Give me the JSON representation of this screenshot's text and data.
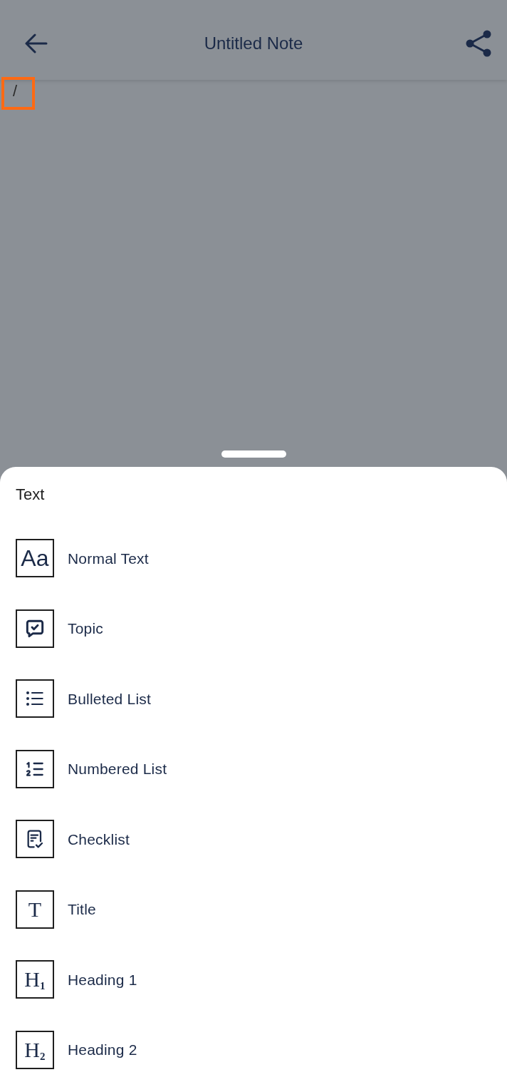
{
  "header": {
    "title": "Untitled Note"
  },
  "note": {
    "text": "/",
    "highlighted": true
  },
  "sheet": {
    "section_label": "Text",
    "items": [
      {
        "kind": "sans-glyph",
        "glyph": "Aa",
        "label": "Normal Text"
      },
      {
        "kind": "topic",
        "label": "Topic"
      },
      {
        "kind": "bulleted",
        "label": "Bulleted List"
      },
      {
        "kind": "numbered",
        "label": "Numbered List"
      },
      {
        "kind": "checklist",
        "label": "Checklist"
      },
      {
        "kind": "serif-glyph",
        "glyph": "T",
        "label": "Title"
      },
      {
        "kind": "serif-glyph",
        "glyph": "H$_{1}$",
        "label": "Heading 1"
      },
      {
        "kind": "serif-glyph",
        "glyph": "H$_{2}$",
        "label": "Heading 2"
      }
    ]
  }
}
